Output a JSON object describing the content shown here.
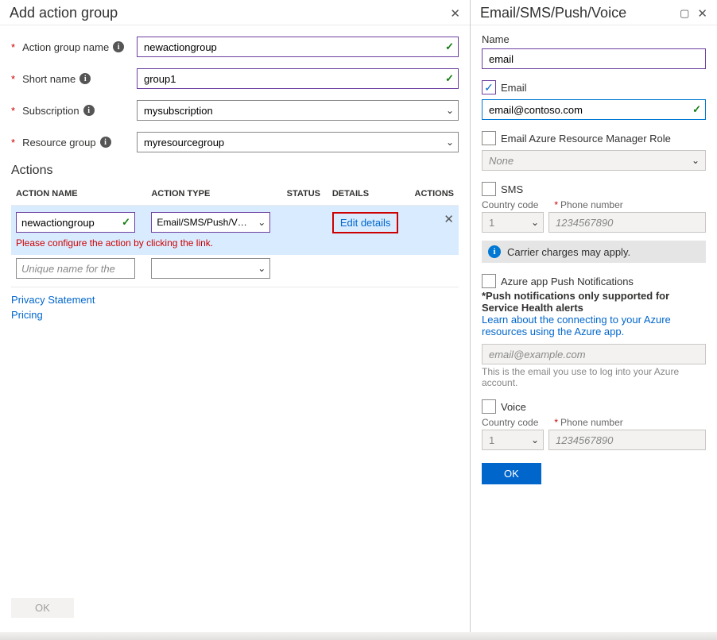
{
  "left": {
    "title": "Add action group",
    "fields": {
      "actionGroupName": {
        "label": "Action group name",
        "value": "newactiongroup"
      },
      "shortName": {
        "label": "Short name",
        "value": "group1"
      },
      "subscription": {
        "label": "Subscription",
        "value": "mysubscription"
      },
      "resourceGroup": {
        "label": "Resource group",
        "value": "myresourcegroup"
      }
    },
    "actionsHeading": "Actions",
    "columns": {
      "name": "ACTION NAME",
      "type": "ACTION TYPE",
      "status": "STATUS",
      "details": "DETAILS",
      "actions": "ACTIONS"
    },
    "row1": {
      "name": "newactiongroup",
      "type": "Email/SMS/Push/V…",
      "details": "Edit details"
    },
    "warn": "Please configure the action by clicking the link.",
    "row2": {
      "placeholder": "Unique name for the act…"
    },
    "links": {
      "privacy": "Privacy Statement",
      "pricing": "Pricing"
    },
    "okLabel": "OK"
  },
  "right": {
    "title": "Email/SMS/Push/Voice",
    "nameLabel": "Name",
    "nameValue": "email",
    "emailLabel": "Email",
    "emailValue": "email@contoso.com",
    "armLabel": "Email Azure Resource Manager Role",
    "armValue": "None",
    "smsLabel": "SMS",
    "ccLabel": "Country code",
    "phoneLabel": "Phone number",
    "cc": "1",
    "phonePh": "1234567890",
    "carrierNote": "Carrier charges may apply.",
    "pushLabel": "Azure app Push Notifications",
    "pushBold": "*Push notifications only supported for Service Health alerts",
    "pushLink": "Learn about the connecting to your Azure resources using the Azure app.",
    "pushPh": "email@example.com",
    "pushHelper": "This is the email you use to log into your Azure account.",
    "voiceLabel": "Voice",
    "okLabel": "OK"
  }
}
